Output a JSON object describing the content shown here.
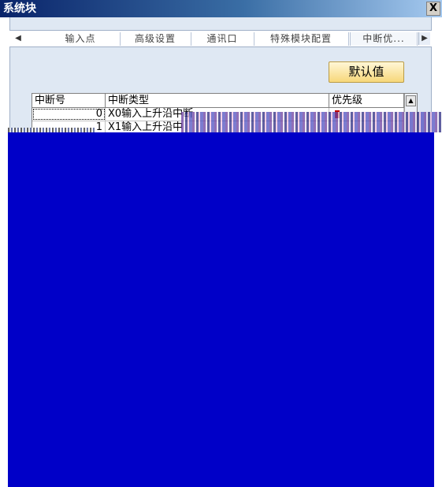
{
  "window": {
    "title": "系统块",
    "close_label": "X"
  },
  "tabs": {
    "left_arrow": "◀",
    "right_arrow": "▶",
    "items": [
      {
        "label": "输入点",
        "active": false
      },
      {
        "label": "高级设置",
        "active": false
      },
      {
        "label": "通讯口",
        "active": false
      },
      {
        "label": "特殊模块配置",
        "active": false
      },
      {
        "label": "中断优...",
        "active": true
      }
    ]
  },
  "toolbar": {
    "default_label": "默认值"
  },
  "grid": {
    "columns": [
      "中断号",
      "中断类型",
      "优先级"
    ],
    "rows": [
      {
        "num": "0",
        "type": "X0输入上升沿中断",
        "priority": ""
      },
      {
        "num": "1",
        "type": "X1输入上升沿中",
        "priority": ""
      }
    ]
  },
  "colors": {
    "title_bar": "#0a246a",
    "panel": "#dfe8f3",
    "default_button": "#f7d77a",
    "overlay_blue": "#0000c8"
  },
  "icons": {
    "scroll_up": "triangle-up-icon",
    "tab_left": "triangle-left-icon",
    "tab_right": "triangle-right-icon",
    "close": "close-icon"
  }
}
